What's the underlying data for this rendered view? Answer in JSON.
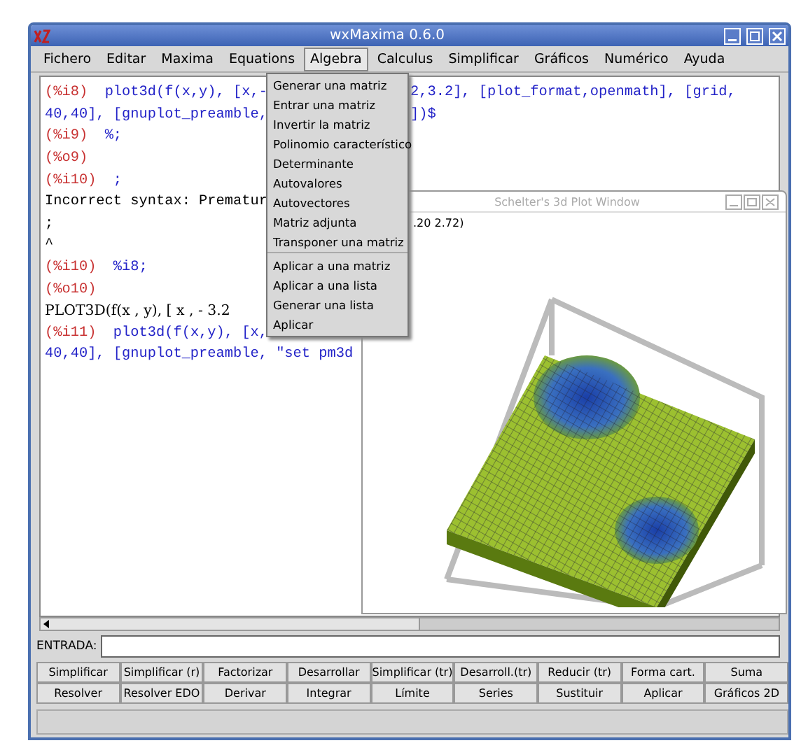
{
  "window": {
    "title": "wxMaxima 0.6.0"
  },
  "menubar": [
    {
      "label": "Fichero",
      "selected": false
    },
    {
      "label": "Editar",
      "selected": false
    },
    {
      "label": "Maxima",
      "selected": false
    },
    {
      "label": "Equations",
      "selected": false
    },
    {
      "label": "Algebra",
      "selected": true
    },
    {
      "label": "Calculus",
      "selected": false
    },
    {
      "label": "Simplificar",
      "selected": false
    },
    {
      "label": "Gráficos",
      "selected": false
    },
    {
      "label": "Numérico",
      "selected": false
    },
    {
      "label": "Ayuda",
      "selected": false
    }
  ],
  "menu": {
    "items": [
      {
        "label": "Generar una matriz",
        "separator_after": false
      },
      {
        "label": "Entrar una matriz",
        "separator_after": false
      },
      {
        "label": "Invertir la matriz",
        "separator_after": false
      },
      {
        "label": "Polinomio característico",
        "separator_after": false
      },
      {
        "label": "Determinante",
        "separator_after": false
      },
      {
        "label": "Autovalores",
        "separator_after": false
      },
      {
        "label": "Autovectores",
        "separator_after": false
      },
      {
        "label": "Matriz adjunta",
        "separator_after": false
      },
      {
        "label": "Transponer una matriz",
        "separator_after": true
      },
      {
        "label": "Aplicar a una matriz",
        "separator_after": false
      },
      {
        "label": "Aplicar a una lista",
        "separator_after": false
      },
      {
        "label": "Generar una lista",
        "separator_after": false
      },
      {
        "label": "Aplicar",
        "separator_after": false
      }
    ]
  },
  "console": {
    "lines": [
      {
        "kind": "input",
        "label": "(%i8)",
        "code": "plot3d(f(x,y), [x,-",
        "after": "2,3.2], [plot_format,openmath], [grid,"
      },
      {
        "kind": "code",
        "code": "40,40], [gnuplot_preamble,",
        "after": "])$"
      },
      {
        "kind": "input",
        "label": "(%i9)",
        "code": "%;"
      },
      {
        "kind": "input",
        "label": "(%o9)"
      },
      {
        "kind": "input",
        "label": "(%i10)",
        "code": ";"
      },
      {
        "kind": "plain",
        "code": "Incorrect syntax: Prematur"
      },
      {
        "kind": "plain",
        "code": ";"
      },
      {
        "kind": "plain",
        "code": "^"
      },
      {
        "kind": "input",
        "label": "(%i10)",
        "code": "%i8;"
      },
      {
        "kind": "input",
        "label": "(%o10)"
      },
      {
        "kind": "math",
        "code": "PLOT3D(f(x , y), [ x , - 3.2"
      },
      {
        "kind": "input",
        "label": "(%i11)",
        "code": "plot3d(f(x,y), [x,"
      },
      {
        "kind": "code",
        "code": "40,40], [gnuplot_preamble, \"set pm3d"
      }
    ]
  },
  "plot_window": {
    "title": "Schelter's 3d Plot Window",
    "coords": ".20 2.72)"
  },
  "input": {
    "label": "ENTRADA:"
  },
  "buttons": [
    [
      "Simplificar",
      "Simplificar (r)",
      "Factorizar",
      "Desarrollar",
      "Simplificar (tr)",
      "Desarroll.(tr)",
      "Reducir (tr)",
      "Forma cart.",
      "Suma"
    ],
    [
      "Resolver",
      "Resolver EDO",
      "Derivar",
      "Integrar",
      "Límite",
      "Series",
      "Sustituir",
      "Aplicar",
      "Gráficos 2D"
    ]
  ]
}
